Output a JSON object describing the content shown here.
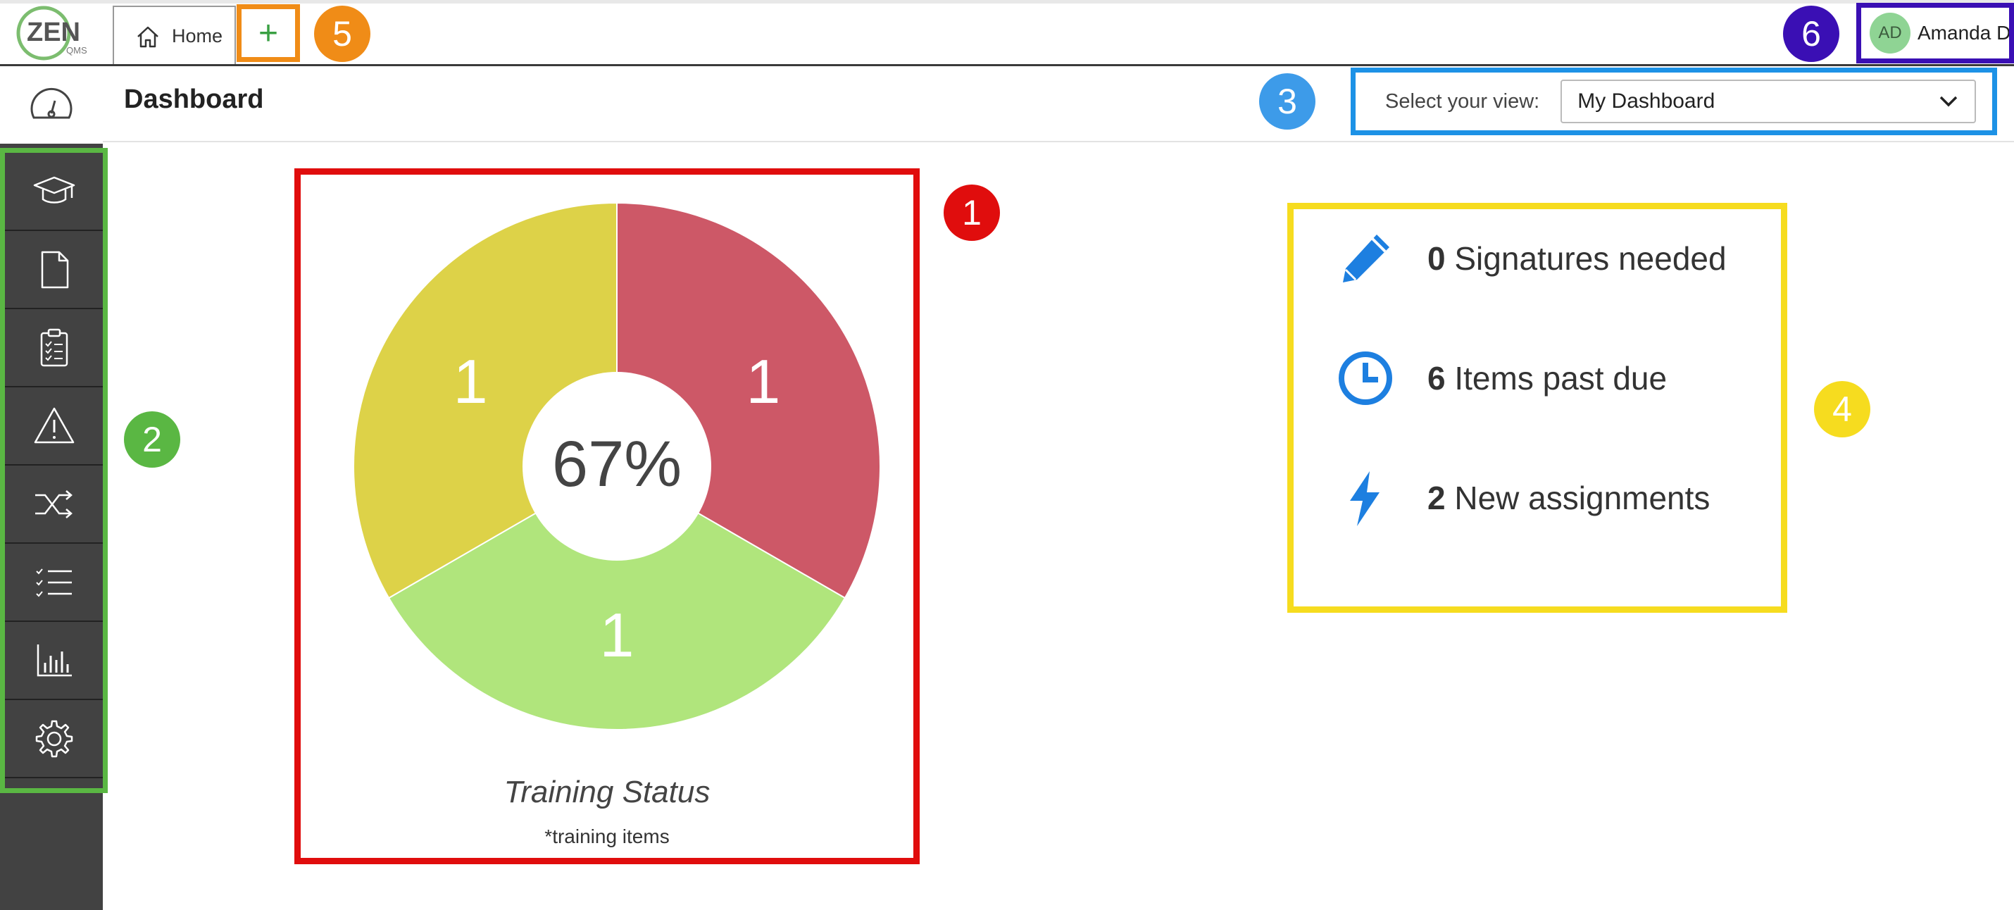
{
  "header": {
    "logo_text": "ZEN",
    "logo_sub": "QMS",
    "home_tab_label": "Home",
    "add_tab_label": "+",
    "user_initials": "AD",
    "user_name": "Amanda D"
  },
  "page": {
    "title": "Dashboard",
    "view_label": "Select your view:",
    "view_value": "My Dashboard"
  },
  "sidebar": {
    "items": [
      {
        "icon": "graduation-cap-icon"
      },
      {
        "icon": "document-icon"
      },
      {
        "icon": "clipboard-icon"
      },
      {
        "icon": "warning-icon"
      },
      {
        "icon": "shuffle-icon"
      },
      {
        "icon": "checklist-icon"
      },
      {
        "icon": "bar-chart-icon"
      },
      {
        "icon": "gear-icon"
      }
    ]
  },
  "callouts": [
    "1",
    "2",
    "3",
    "4",
    "5",
    "6"
  ],
  "chart_data": {
    "type": "pie",
    "title": "Training Status",
    "subtitle": "*training items",
    "center_label": "67%",
    "slices": [
      {
        "value": 1,
        "color": "#cd5867"
      },
      {
        "value": 1,
        "color": "#b0e57c"
      },
      {
        "value": 1,
        "color": "#ddd248"
      }
    ]
  },
  "summary": {
    "items": [
      {
        "count": "0",
        "label": "Signatures needed",
        "icon": "pencil-icon"
      },
      {
        "count": "6",
        "label": "Items past due",
        "icon": "clock-icon"
      },
      {
        "count": "2",
        "label": "New assignments",
        "icon": "lightning-icon"
      }
    ]
  },
  "colors": {
    "accent_blue": "#1d7fe0",
    "sidebar": "#424242",
    "callout_red": "#e00d0d",
    "callout_green": "#5ab743",
    "callout_blue": "#3d9be9",
    "callout_yellow": "#f6dc1f",
    "callout_orange": "#f08c17",
    "callout_purple": "#3a0fb4"
  }
}
